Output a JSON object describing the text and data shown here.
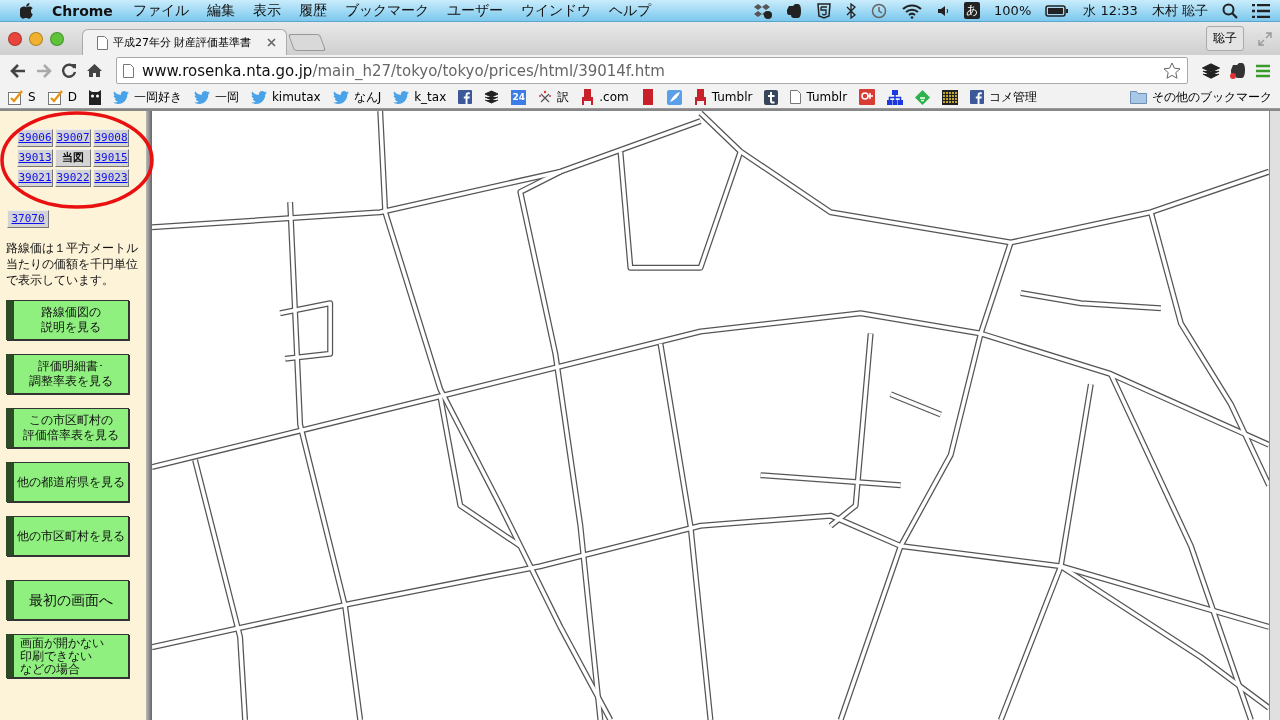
{
  "menu_bar": {
    "app": "Chrome",
    "menus": [
      "ファイル",
      "編集",
      "表示",
      "履歴",
      "ブックマーク",
      "ユーザー",
      "ウインドウ",
      "ヘルプ"
    ],
    "status": {
      "ime": "あ",
      "battery": "100%",
      "day": "水",
      "time": "12:33",
      "user": "木村 聡子"
    }
  },
  "browser": {
    "tabs": [
      {
        "title": "平成27年分 財産評価基準書",
        "selected": true
      }
    ],
    "profile": "聡子",
    "url": {
      "host": "www.rosenka.nta.go.jp",
      "path": "/main_h27/tokyo/tokyo/prices/html/39014f.htm"
    },
    "bookmarks": [
      {
        "kind": "check",
        "label": "S"
      },
      {
        "kind": "check",
        "label": "D"
      },
      {
        "kind": "owl"
      },
      {
        "kind": "bird",
        "label": "一岡好き"
      },
      {
        "kind": "bird",
        "label": "一岡"
      },
      {
        "kind": "bird",
        "label": "kimutax"
      },
      {
        "kind": "bird",
        "label": "なんJ"
      },
      {
        "kind": "bird",
        "label": "k_tax"
      },
      {
        "kind": "facebook"
      },
      {
        "kind": "layers"
      },
      {
        "kind": "calendar",
        "icon_text": "24"
      },
      {
        "kind": "translate",
        "label": "訳"
      },
      {
        "kind": "figure",
        "label": ".com"
      },
      {
        "kind": "redblock"
      },
      {
        "kind": "feather"
      },
      {
        "kind": "figure",
        "label": "Tumblr"
      },
      {
        "kind": "tumblr"
      },
      {
        "kind": "page",
        "label": "Tumblr"
      },
      {
        "kind": "gplus"
      },
      {
        "kind": "sitemap"
      },
      {
        "kind": "feedly"
      },
      {
        "kind": "grid"
      },
      {
        "kind": "facebook",
        "label": "コメ管理"
      }
    ],
    "other_bookmarks": "その他のブックマーク"
  },
  "sidebar": {
    "map_links": [
      {
        "label": "39006",
        "current": false
      },
      {
        "label": "39007",
        "current": false
      },
      {
        "label": "39008",
        "current": false
      },
      {
        "label": "39013",
        "current": false
      },
      {
        "label": "当図",
        "current": true
      },
      {
        "label": "39015",
        "current": false
      },
      {
        "label": "39021",
        "current": false
      },
      {
        "label": "39022",
        "current": false
      },
      {
        "label": "39023",
        "current": false
      }
    ],
    "extra_link": "37070",
    "note": "路線価は１平方メートル当たりの価額を千円単位で表示しています。",
    "buttons": [
      {
        "kind": "normal",
        "lines": [
          "路線価図の",
          "説明を見る"
        ]
      },
      {
        "kind": "normal",
        "lines": [
          "評価明細書･",
          "調整率表を見る"
        ]
      },
      {
        "kind": "normal",
        "lines": [
          "この市区町村の",
          "評価倍率表を見る"
        ]
      },
      {
        "kind": "normal",
        "lines": [
          "他の都道府県を見る"
        ]
      },
      {
        "kind": "normal",
        "lines": [
          "他の市区町村を見る"
        ]
      },
      {
        "kind": "large",
        "lines": [
          "最初の画面へ"
        ]
      },
      {
        "kind": "compact",
        "lines": [
          "画面が開かない",
          "印刷できない",
          "などの場合"
        ]
      }
    ]
  }
}
